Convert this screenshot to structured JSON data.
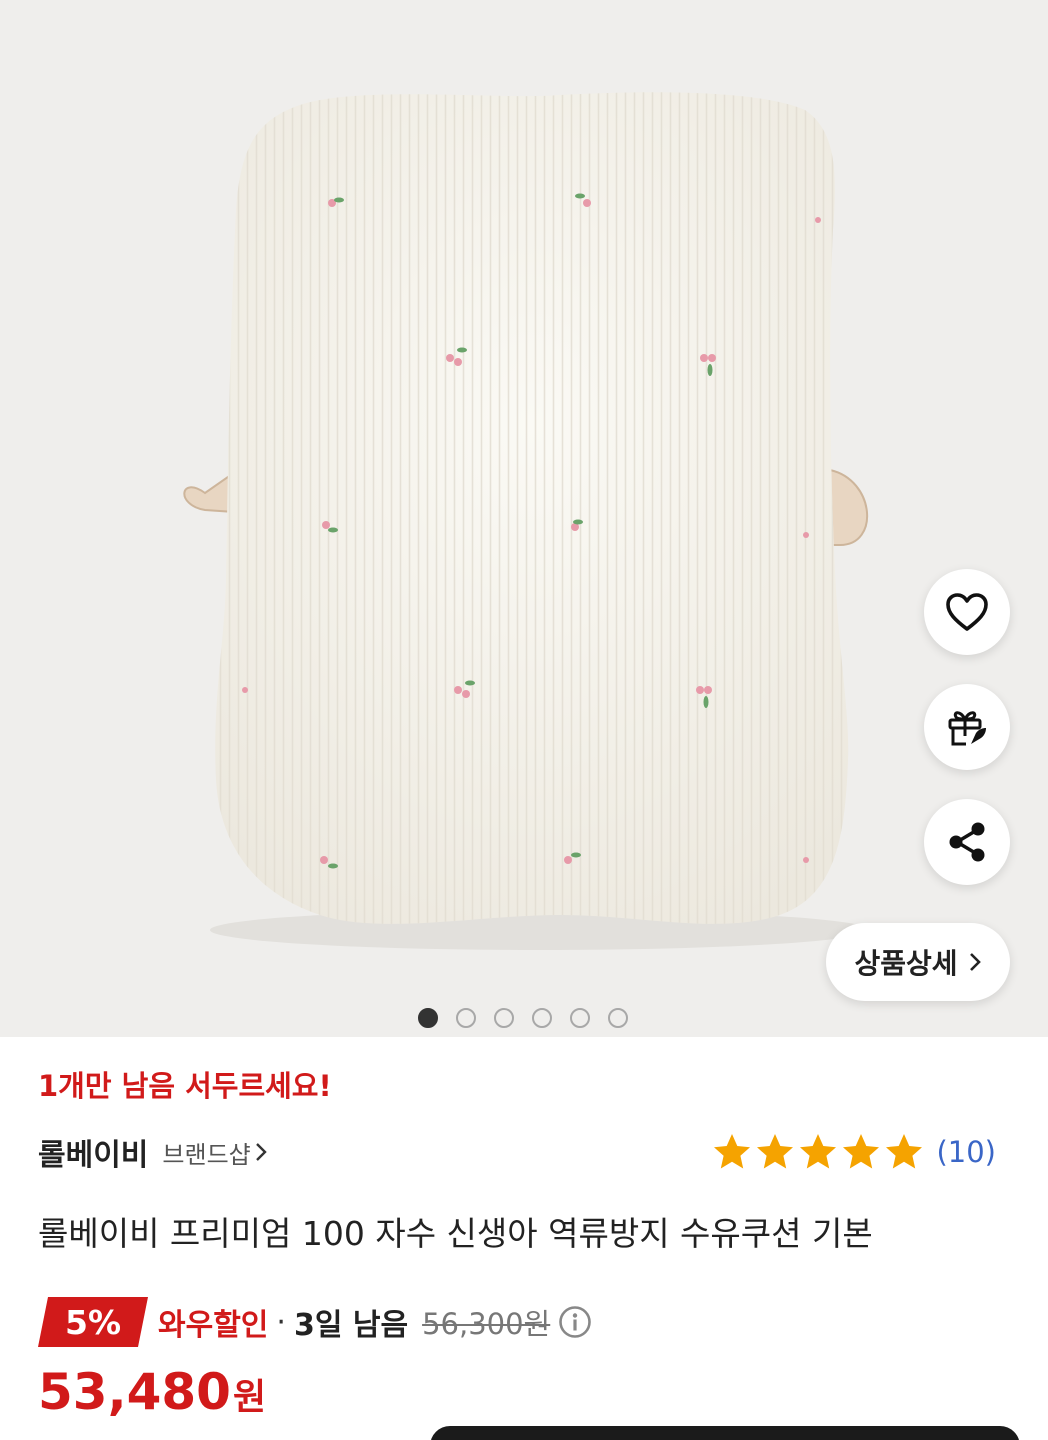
{
  "product_gallery": {
    "image_alt": "롤베이비 수유쿠션 상품 이미지",
    "slide_count": 6,
    "active_slide": 1
  },
  "actions": {
    "like_icon": "heart-icon",
    "gift_icon": "gift-rocket-icon",
    "share_icon": "share-icon",
    "detail_label": "상품상세"
  },
  "stock_notice": "1개만 남음 서두르세요!",
  "brand": {
    "name": "롤베이비",
    "shop_label": "브랜드샵"
  },
  "rating": {
    "stars": 5,
    "count_label": "(10)"
  },
  "product_title": "롤베이비 프리미엄 100 자수 신생아 역류방지 수유쿠션 기본",
  "discount": {
    "percent": "5%",
    "label": "와우할인",
    "separator": "·",
    "time_left": "3일 남음",
    "original_price": "56,300원"
  },
  "price": {
    "amount": "53,480",
    "currency": "원"
  },
  "colors": {
    "accent_red": "#d11a1a",
    "star": "#f5a300",
    "review_link": "#3a66c7"
  }
}
